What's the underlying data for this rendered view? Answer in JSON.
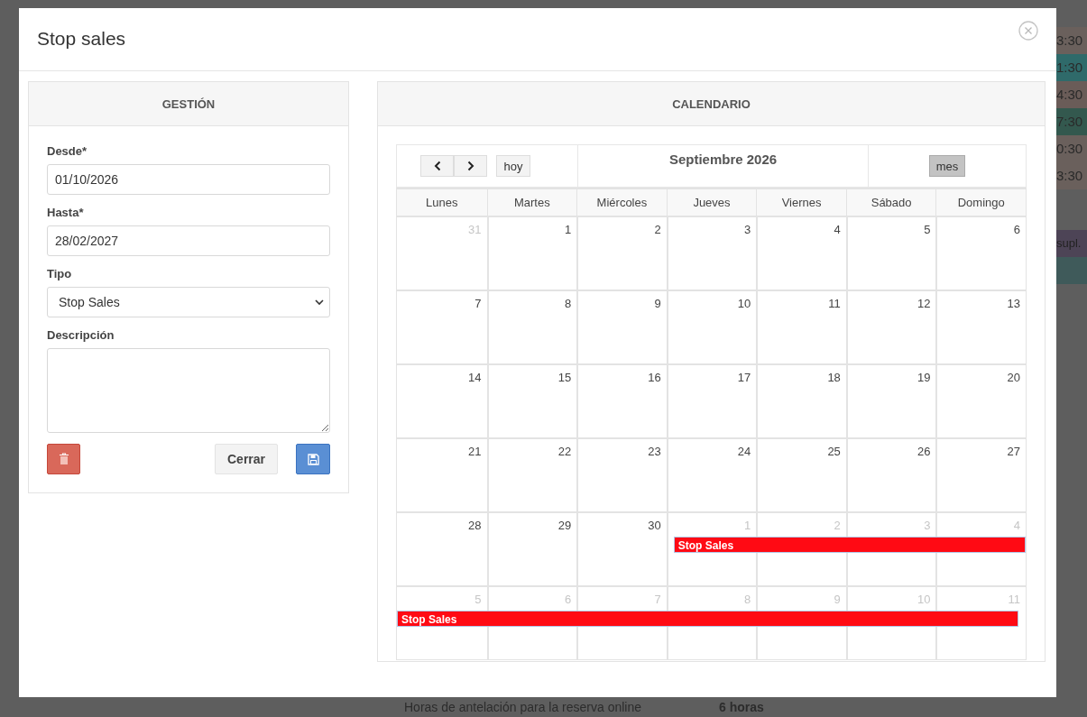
{
  "background": {
    "times": [
      {
        "label": "3:30",
        "color": "#6a605c"
      },
      {
        "label": "1:30",
        "color": "#2f6a6a"
      },
      {
        "label": "4:30",
        "color": "#6a5c58"
      },
      {
        "label": "7:30",
        "color": "#33584e"
      },
      {
        "label": "0:30",
        "color": "#6a605c"
      },
      {
        "label": "3:30",
        "color": "#6a605c"
      }
    ],
    "tag": "supl.",
    "setting_label": "Horas de antelación para la reserva online",
    "setting_value": "6 horas"
  },
  "modal": {
    "title": "Stop sales",
    "gestion": {
      "header": "GESTIÓN",
      "fields": [
        {
          "kind": "input",
          "label": "Desde*",
          "value": "01/10/2026"
        },
        {
          "kind": "input",
          "label": "Hasta*",
          "value": "28/02/2027"
        },
        {
          "kind": "select",
          "label": "Tipo",
          "value": "Stop Sales"
        },
        {
          "kind": "textarea",
          "label": "Descripción"
        }
      ],
      "close_button": "Cerrar"
    },
    "calendar": {
      "header": "CALENDARIO",
      "today_button": "hoy",
      "month_title": "Septiembre 2026",
      "view_button": {
        "label": "mes",
        "selected": true
      },
      "weekdays": [
        "Lunes",
        "Martes",
        "Miércoles",
        "Jueves",
        "Viernes",
        "Sábado",
        "Domingo"
      ],
      "weeks": [
        {
          "days": [
            {
              "number": "31",
              "other_month": true
            },
            {
              "number": "1",
              "other_month": false
            },
            {
              "number": "2",
              "other_month": false
            },
            {
              "number": "3",
              "other_month": false
            },
            {
              "number": "4",
              "other_month": false
            },
            {
              "number": "5",
              "other_month": false
            },
            {
              "number": "6",
              "other_month": false
            }
          ]
        },
        {
          "days": [
            {
              "number": "7",
              "other_month": false
            },
            {
              "number": "8",
              "other_month": false
            },
            {
              "number": "9",
              "other_month": false
            },
            {
              "number": "10",
              "other_month": false
            },
            {
              "number": "11",
              "other_month": false
            },
            {
              "number": "12",
              "other_month": false
            },
            {
              "number": "13",
              "other_month": false
            }
          ]
        },
        {
          "days": [
            {
              "number": "14",
              "other_month": false
            },
            {
              "number": "15",
              "other_month": false
            },
            {
              "number": "16",
              "other_month": false
            },
            {
              "number": "17",
              "other_month": false
            },
            {
              "number": "18",
              "other_month": false
            },
            {
              "number": "19",
              "other_month": false
            },
            {
              "number": "20",
              "other_month": false
            }
          ]
        },
        {
          "days": [
            {
              "number": "21",
              "other_month": false
            },
            {
              "number": "22",
              "other_month": false
            },
            {
              "number": "23",
              "other_month": false
            },
            {
              "number": "24",
              "other_month": false
            },
            {
              "number": "25",
              "other_month": false
            },
            {
              "number": "26",
              "other_month": false
            },
            {
              "number": "27",
              "other_month": false
            }
          ]
        },
        {
          "days": [
            {
              "number": "28",
              "other_month": false
            },
            {
              "number": "29",
              "other_month": false
            },
            {
              "number": "30",
              "other_month": false
            },
            {
              "number": "1",
              "other_month": true,
              "stop_sale": true
            },
            {
              "number": "2",
              "other_month": true,
              "stop_sale": true
            },
            {
              "number": "3",
              "other_month": true,
              "stop_sale": true
            },
            {
              "number": "4",
              "other_month": true,
              "stop_sale": true
            }
          ],
          "event": {
            "label": "Stop Sales",
            "color": "#ff0a14"
          }
        },
        {
          "days": [
            {
              "number": "5",
              "other_month": true,
              "stop_sale": true
            },
            {
              "number": "6",
              "other_month": true,
              "stop_sale": true
            },
            {
              "number": "7",
              "other_month": true,
              "stop_sale": true
            },
            {
              "number": "8",
              "other_month": true,
              "stop_sale": true
            },
            {
              "number": "9",
              "other_month": true,
              "stop_sale": true
            },
            {
              "number": "10",
              "other_month": true,
              "stop_sale": true
            },
            {
              "number": "11",
              "other_month": true,
              "stop_sale": true
            }
          ],
          "event": {
            "label": "Stop Sales",
            "color": "#ff0a14"
          }
        }
      ]
    }
  }
}
